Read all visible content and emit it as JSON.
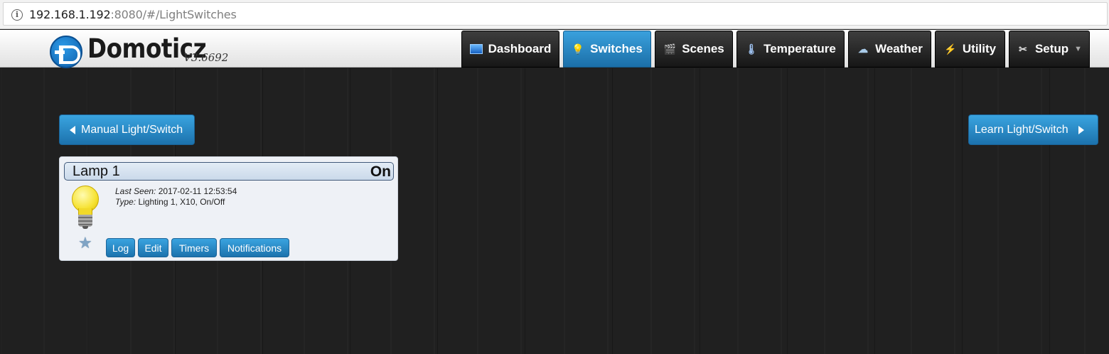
{
  "browser": {
    "url_host": "192.168.1.192",
    "url_rest": ":8080/#/LightSwitches"
  },
  "header": {
    "logo_text": "Domoticz",
    "version": "V3.6692",
    "nav": [
      {
        "label": "Dashboard",
        "icon": "dashboard-icon"
      },
      {
        "label": "Switches",
        "icon": "lightbulb-icon",
        "active": true
      },
      {
        "label": "Scenes",
        "icon": "clapperboard-icon"
      },
      {
        "label": "Temperature",
        "icon": "thermometer-icon"
      },
      {
        "label": "Weather",
        "icon": "cloud-icon"
      },
      {
        "label": "Utility",
        "icon": "utility-icon"
      },
      {
        "label": "Setup",
        "icon": "tools-icon"
      }
    ]
  },
  "actions": {
    "manual": "Manual Light/Switch",
    "learn": "Learn Light/Switch"
  },
  "device": {
    "name": "Lamp 1",
    "status": "On",
    "last_seen_label": "Last Seen:",
    "last_seen": "2017-02-11 12:53:54",
    "type_label": "Type:",
    "type": "Lighting 1, X10, On/Off",
    "buttons": [
      "Log",
      "Edit",
      "Timers",
      "Notifications"
    ]
  },
  "colors": {
    "accent": "#1c72ad",
    "nav_dark": "#161616",
    "background": "#202020"
  }
}
